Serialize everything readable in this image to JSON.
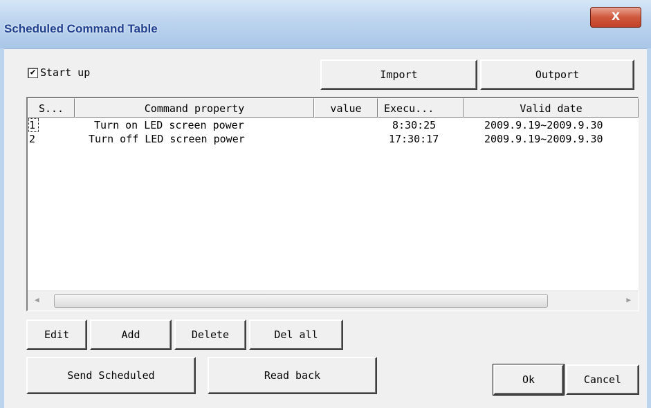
{
  "window": {
    "title": "Scheduled Command Table",
    "close_glyph": "X"
  },
  "startup": {
    "label": "Start up",
    "checked": true,
    "mark": "✔"
  },
  "buttons": {
    "import": "Import",
    "outport": "Outport",
    "edit": "Edit",
    "add": "Add",
    "delete": "Delete",
    "del_all": "Del all",
    "send_scheduled": "Send Scheduled",
    "read_back": "Read back",
    "ok": "Ok",
    "cancel": "Cancel"
  },
  "table": {
    "columns": [
      "S...",
      "Command property",
      "value",
      "Execu...",
      "Valid date"
    ],
    "rows": [
      {
        "seq": "1",
        "command": "Turn on LED screen power",
        "value": "",
        "exec": "8:30:25",
        "valid": "2009.9.19~2009.9.30"
      },
      {
        "seq": "2",
        "command": "Turn off LED screen power",
        "value": "",
        "exec": "17:30:17",
        "valid": "2009.9.19~2009.9.30"
      }
    ]
  },
  "scrollbar": {
    "left_arrow": "◀",
    "right_arrow": "▶"
  }
}
